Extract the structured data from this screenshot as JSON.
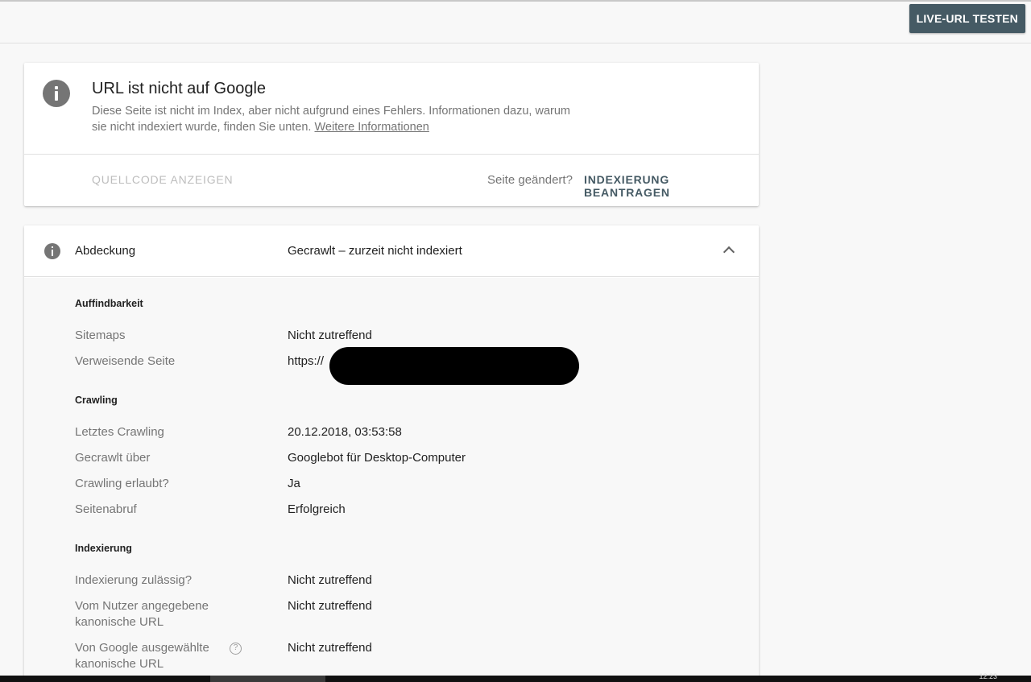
{
  "header": {
    "live_test_button": "LIVE-URL TESTEN"
  },
  "status_card": {
    "icon": "info-icon",
    "title": "URL ist nicht auf Google",
    "description": "Diese Seite ist nicht im Index, aber nicht aufgrund eines Fehlers. Informationen dazu, warum sie nicht indexiert wurde, finden Sie unten.",
    "more_info_link": "Weitere Informationen",
    "view_source_button": "QUELLCODE ANZEIGEN",
    "page_changed_label": "Seite geändert?",
    "request_indexing_button": "INDEXIERUNG BEANTRAGEN"
  },
  "coverage": {
    "icon": "info-icon",
    "label": "Abdeckung",
    "value": "Gecrawlt – zurzeit nicht indexiert",
    "expanded": true,
    "sections": [
      {
        "title": "Auffindbarkeit",
        "rows": [
          {
            "label": "Sitemaps",
            "value": "Nicht zutreffend"
          },
          {
            "label": "Verweisende Seite",
            "value": "https://"
          }
        ]
      },
      {
        "title": "Crawling",
        "rows": [
          {
            "label": "Letztes Crawling",
            "value": "20.12.2018, 03:53:58"
          },
          {
            "label": "Gecrawlt über",
            "value": "Googlebot für Desktop-Computer"
          },
          {
            "label": "Crawling erlaubt?",
            "value": "Ja"
          },
          {
            "label": "Seitenabruf",
            "value": "Erfolgreich"
          }
        ]
      },
      {
        "title": "Indexierung",
        "rows": [
          {
            "label": "Indexierung zulässig?",
            "value": "Nicht zutreffend"
          },
          {
            "label": "Vom Nutzer angegebene kanonische URL",
            "value": "Nicht zutreffend"
          },
          {
            "label": "Von Google ausgewählte kanonische URL",
            "value": "Nicht zutreffend"
          }
        ]
      }
    ]
  },
  "taskbar": {
    "clock": "12:23"
  },
  "colors": {
    "primary_button": "#455a64",
    "icon_grey": "#757575",
    "background": "#f8f8f8"
  }
}
